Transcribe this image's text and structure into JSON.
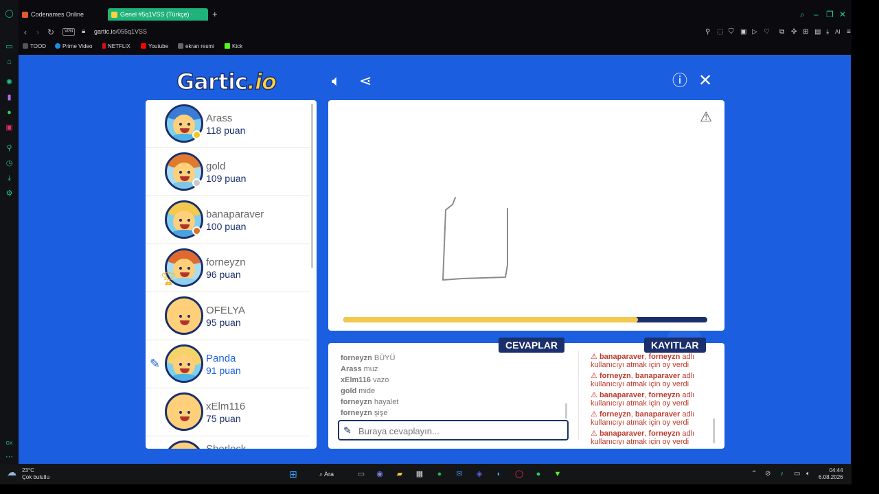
{
  "browser": {
    "tabs": [
      {
        "label": "Codenames Online",
        "active": false
      },
      {
        "label": "Genel #5q1VSS (Türkçe) ·",
        "active": true
      }
    ],
    "url_domain": "gartic.io",
    "url_path": "/055q1VSS",
    "vpn_label": "VPN",
    "bookmarks": [
      "TOOD",
      "Prime Video",
      "NETFLIX",
      "Youtube",
      "ekran resmi",
      "Kick"
    ],
    "ai_label": "AI"
  },
  "game": {
    "logo_main": "Gartic",
    "logo_suffix": ".io",
    "players": [
      {
        "name": "Arass",
        "points": "118 puan",
        "hair": "#3a7bd5",
        "shirt": "#4db3e6",
        "dot": "#f5c518"
      },
      {
        "name": "gold",
        "points": "109 puan",
        "hair": "#e07a2e",
        "shirt": "#7fc6e8",
        "dot": "#c8c8c8"
      },
      {
        "name": "banaparaver",
        "points": "100 puan",
        "hair": "#f2c94c",
        "shirt": "#4aa3df",
        "dot": "#d9731f"
      },
      {
        "name": "forneyzn",
        "points": "96 puan",
        "hair": "#e06a2e",
        "shirt": "#8fd0ef",
        "dot": ""
      },
      {
        "name": "OFELYA",
        "points": "95 puan",
        "hair": "#ffcf7a",
        "shirt": "#ffcf7a",
        "dot": ""
      },
      {
        "name": "Panda",
        "points": "91 puan",
        "hair": "#f4d46a",
        "shirt": "#4db3e6",
        "dot": ""
      },
      {
        "name": "xElm116",
        "points": "75 puan",
        "hair": "#ffcf7a",
        "shirt": "#ffcf7a",
        "dot": ""
      },
      {
        "name": "Sherlock",
        "points": "",
        "hair": "#ffcf7a",
        "shirt": "#ffcf7a",
        "dot": ""
      }
    ],
    "timer_progress": 0.81,
    "answers_title": "CEVAPLAR",
    "logs_title": "KAYITLAR",
    "answers": [
      {
        "user": "forneyzn",
        "text": "BÜYÜ"
      },
      {
        "user": "Arass",
        "text": "muz"
      },
      {
        "user": "xElm116",
        "text": "vazo"
      },
      {
        "user": "gold",
        "text": "mide"
      },
      {
        "user": "forneyzn",
        "text": "hayalet"
      },
      {
        "user": "forneyzn",
        "text": "şişe"
      }
    ],
    "answer_placeholder": "Buraya cevaplayın...",
    "logs": [
      {
        "a": "banaparaver",
        "b": "forneyzn",
        "rest": "adlı kullanıcıyı atmak için oy verdi"
      },
      {
        "a": "forneyzn",
        "b": "banaparaver",
        "rest": "adlı kullanıcıyı atmak için oy verdi"
      },
      {
        "a": "banaparaver",
        "b": "forneyzn",
        "rest": "adlı kullanıcıyı atmak için oy verdi"
      },
      {
        "a": "forneyzn",
        "b": "banaparaver",
        "rest": "adlı kullanıcıyı atmak için oy verdi"
      },
      {
        "a": "banaparaver",
        "b": "forneyzn",
        "rest": "adlı kullanıcıyı atmak için oy verdi"
      }
    ]
  },
  "taskbar": {
    "temp": "23°C",
    "weather": "Çok bulutlu",
    "search_label": "Ara",
    "time": "04:44",
    "date": "6.08.2026"
  },
  "colors": {
    "page_bg": "#1b5fe0",
    "navy": "#1a2f6b",
    "accent_green": "#1fb27a",
    "timer_fill": "#f2c94c"
  }
}
